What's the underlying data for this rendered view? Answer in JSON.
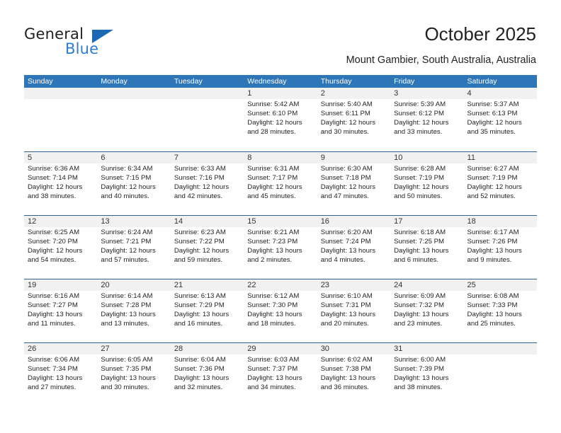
{
  "brand": {
    "name_part1": "General",
    "name_part2": "Blue",
    "triangle_color": "#1b69b2",
    "blue_color": "#2d7dd2"
  },
  "header": {
    "title": "October 2025",
    "location": "Mount Gambier, South Australia, Australia"
  },
  "theme": {
    "header_bg": "#2f76b8",
    "header_text": "#ffffff",
    "row_divider": "#31628f",
    "daynum_bg": "#f1f1f1"
  },
  "weekdays": [
    "Sunday",
    "Monday",
    "Tuesday",
    "Wednesday",
    "Thursday",
    "Friday",
    "Saturday"
  ],
  "weeks": [
    [
      {
        "day": "",
        "lines": []
      },
      {
        "day": "",
        "lines": []
      },
      {
        "day": "",
        "lines": []
      },
      {
        "day": "1",
        "lines": [
          "Sunrise: 5:42 AM",
          "Sunset: 6:10 PM",
          "Daylight: 12 hours and 28 minutes."
        ]
      },
      {
        "day": "2",
        "lines": [
          "Sunrise: 5:40 AM",
          "Sunset: 6:11 PM",
          "Daylight: 12 hours and 30 minutes."
        ]
      },
      {
        "day": "3",
        "lines": [
          "Sunrise: 5:39 AM",
          "Sunset: 6:12 PM",
          "Daylight: 12 hours and 33 minutes."
        ]
      },
      {
        "day": "4",
        "lines": [
          "Sunrise: 5:37 AM",
          "Sunset: 6:13 PM",
          "Daylight: 12 hours and 35 minutes."
        ]
      }
    ],
    [
      {
        "day": "5",
        "lines": [
          "Sunrise: 6:36 AM",
          "Sunset: 7:14 PM",
          "Daylight: 12 hours and 38 minutes."
        ]
      },
      {
        "day": "6",
        "lines": [
          "Sunrise: 6:34 AM",
          "Sunset: 7:15 PM",
          "Daylight: 12 hours and 40 minutes."
        ]
      },
      {
        "day": "7",
        "lines": [
          "Sunrise: 6:33 AM",
          "Sunset: 7:16 PM",
          "Daylight: 12 hours and 42 minutes."
        ]
      },
      {
        "day": "8",
        "lines": [
          "Sunrise: 6:31 AM",
          "Sunset: 7:17 PM",
          "Daylight: 12 hours and 45 minutes."
        ]
      },
      {
        "day": "9",
        "lines": [
          "Sunrise: 6:30 AM",
          "Sunset: 7:18 PM",
          "Daylight: 12 hours and 47 minutes."
        ]
      },
      {
        "day": "10",
        "lines": [
          "Sunrise: 6:28 AM",
          "Sunset: 7:19 PM",
          "Daylight: 12 hours and 50 minutes."
        ]
      },
      {
        "day": "11",
        "lines": [
          "Sunrise: 6:27 AM",
          "Sunset: 7:19 PM",
          "Daylight: 12 hours and 52 minutes."
        ]
      }
    ],
    [
      {
        "day": "12",
        "lines": [
          "Sunrise: 6:25 AM",
          "Sunset: 7:20 PM",
          "Daylight: 12 hours and 54 minutes."
        ]
      },
      {
        "day": "13",
        "lines": [
          "Sunrise: 6:24 AM",
          "Sunset: 7:21 PM",
          "Daylight: 12 hours and 57 minutes."
        ]
      },
      {
        "day": "14",
        "lines": [
          "Sunrise: 6:23 AM",
          "Sunset: 7:22 PM",
          "Daylight: 12 hours and 59 minutes."
        ]
      },
      {
        "day": "15",
        "lines": [
          "Sunrise: 6:21 AM",
          "Sunset: 7:23 PM",
          "Daylight: 13 hours and 2 minutes."
        ]
      },
      {
        "day": "16",
        "lines": [
          "Sunrise: 6:20 AM",
          "Sunset: 7:24 PM",
          "Daylight: 13 hours and 4 minutes."
        ]
      },
      {
        "day": "17",
        "lines": [
          "Sunrise: 6:18 AM",
          "Sunset: 7:25 PM",
          "Daylight: 13 hours and 6 minutes."
        ]
      },
      {
        "day": "18",
        "lines": [
          "Sunrise: 6:17 AM",
          "Sunset: 7:26 PM",
          "Daylight: 13 hours and 9 minutes."
        ]
      }
    ],
    [
      {
        "day": "19",
        "lines": [
          "Sunrise: 6:16 AM",
          "Sunset: 7:27 PM",
          "Daylight: 13 hours and 11 minutes."
        ]
      },
      {
        "day": "20",
        "lines": [
          "Sunrise: 6:14 AM",
          "Sunset: 7:28 PM",
          "Daylight: 13 hours and 13 minutes."
        ]
      },
      {
        "day": "21",
        "lines": [
          "Sunrise: 6:13 AM",
          "Sunset: 7:29 PM",
          "Daylight: 13 hours and 16 minutes."
        ]
      },
      {
        "day": "22",
        "lines": [
          "Sunrise: 6:12 AM",
          "Sunset: 7:30 PM",
          "Daylight: 13 hours and 18 minutes."
        ]
      },
      {
        "day": "23",
        "lines": [
          "Sunrise: 6:10 AM",
          "Sunset: 7:31 PM",
          "Daylight: 13 hours and 20 minutes."
        ]
      },
      {
        "day": "24",
        "lines": [
          "Sunrise: 6:09 AM",
          "Sunset: 7:32 PM",
          "Daylight: 13 hours and 23 minutes."
        ]
      },
      {
        "day": "25",
        "lines": [
          "Sunrise: 6:08 AM",
          "Sunset: 7:33 PM",
          "Daylight: 13 hours and 25 minutes."
        ]
      }
    ],
    [
      {
        "day": "26",
        "lines": [
          "Sunrise: 6:06 AM",
          "Sunset: 7:34 PM",
          "Daylight: 13 hours and 27 minutes."
        ]
      },
      {
        "day": "27",
        "lines": [
          "Sunrise: 6:05 AM",
          "Sunset: 7:35 PM",
          "Daylight: 13 hours and 30 minutes."
        ]
      },
      {
        "day": "28",
        "lines": [
          "Sunrise: 6:04 AM",
          "Sunset: 7:36 PM",
          "Daylight: 13 hours and 32 minutes."
        ]
      },
      {
        "day": "29",
        "lines": [
          "Sunrise: 6:03 AM",
          "Sunset: 7:37 PM",
          "Daylight: 13 hours and 34 minutes."
        ]
      },
      {
        "day": "30",
        "lines": [
          "Sunrise: 6:02 AM",
          "Sunset: 7:38 PM",
          "Daylight: 13 hours and 36 minutes."
        ]
      },
      {
        "day": "31",
        "lines": [
          "Sunrise: 6:00 AM",
          "Sunset: 7:39 PM",
          "Daylight: 13 hours and 38 minutes."
        ]
      },
      {
        "day": "",
        "lines": []
      }
    ]
  ]
}
